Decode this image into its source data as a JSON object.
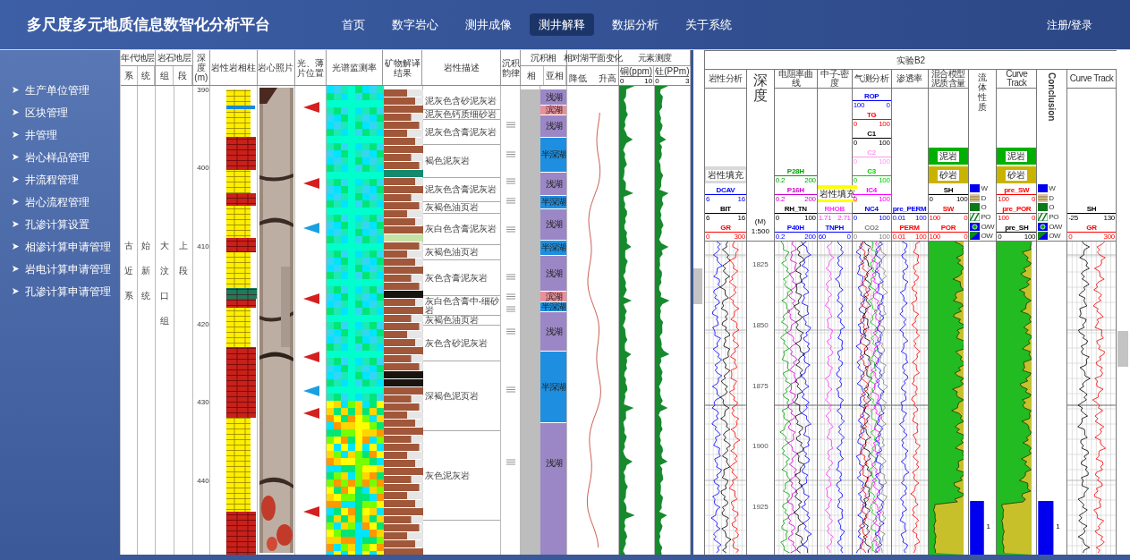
{
  "header": {
    "title": "多尺度多元地质信息数智化分析平台",
    "nav": [
      {
        "label": "首页",
        "selected": false
      },
      {
        "label": "数字岩心",
        "selected": false
      },
      {
        "label": "测井成像",
        "selected": false
      },
      {
        "label": "测井解释",
        "selected": true
      },
      {
        "label": "数据分析",
        "selected": false
      },
      {
        "label": "关于系统",
        "selected": false
      }
    ],
    "login": "注册/登录"
  },
  "sidebar": {
    "items": [
      "生产单位管理",
      "区块管理",
      "井管理",
      "岩心样品管理",
      "井流程管理",
      "岩心流程管理",
      "孔渗计算设置",
      "相渗计算申请管理",
      "岩电计算申请管理",
      "孔渗计算申请管理"
    ]
  },
  "core_log": {
    "columns": [
      {
        "label": "年代地层",
        "sub": [
          "系",
          "统"
        ]
      },
      {
        "label": "岩石地层",
        "sub": [
          "组",
          "段"
        ]
      },
      {
        "label": "深度(m)"
      },
      {
        "label": "岩性岩相柱"
      },
      {
        "label": "岩心照片"
      },
      {
        "label": "光、薄片位置"
      },
      {
        "label": "光谱监测率"
      },
      {
        "label": "矿物解译结果"
      },
      {
        "label": "岩性描述"
      },
      {
        "label": "沉积韵律"
      },
      {
        "label": "沉积相",
        "sub": [
          "相",
          "亚相"
        ]
      },
      {
        "label": "相对湖平面变化",
        "sub": [
          "降低",
          "升高"
        ]
      },
      {
        "label": "元素测度",
        "sub": [
          "铜(ppm)",
          "钍(PPm)"
        ],
        "scales": [
          [
            "0",
            "10"
          ],
          [
            "0",
            "3"
          ]
        ]
      }
    ],
    "strata": [
      "古近系",
      "始新统",
      "大汶口组",
      "上段"
    ],
    "depth_ticks": [
      "390",
      "400",
      "410",
      "420",
      "430",
      "440"
    ],
    "sample_markers": [
      {
        "color": "#d42020"
      },
      {
        "color": "#d42020"
      },
      {
        "color": "#1aa0e0"
      },
      {
        "color": "#d42020"
      },
      {
        "color": "#d42020"
      },
      {
        "color": "#1aa0e0"
      },
      {
        "color": "#d42020"
      },
      {
        "color": "#d42020"
      }
    ],
    "descriptions": [
      "泥灰色含砂泥灰岩",
      "泥灰色钙质细砂岩",
      "泥灰色含膏泥灰岩",
      "褐色泥灰岩",
      "泥灰色含膏泥灰岩",
      "灰褐色油页岩",
      "灰白色含膏泥灰岩",
      "灰褐色油页岩",
      "灰色含膏泥灰岩",
      "灰白色含膏中-细砂岩",
      "灰褐色油页岩",
      "灰色含砂泥灰岩",
      "深褐色泥页岩",
      "灰色泥灰岩"
    ],
    "facies": [
      {
        "label": "浅湖",
        "color": "#9b87c6"
      },
      {
        "label": "滨湖",
        "color": "#e8909a"
      },
      {
        "label": "浅湖",
        "color": "#9b87c6"
      },
      {
        "label": "半深湖",
        "color": "#1e8fe0"
      },
      {
        "label": "浅湖",
        "color": "#9b87c6"
      },
      {
        "label": "半深湖",
        "color": "#1e8fe0"
      },
      {
        "label": "浅湖",
        "color": "#9b87c6"
      },
      {
        "label": "半深湖",
        "color": "#1e8fe0"
      },
      {
        "label": "浅湖",
        "color": "#9b87c6"
      },
      {
        "label": "滨湖",
        "color": "#e8909a"
      },
      {
        "label": "半深湖",
        "color": "#1e8fe0"
      },
      {
        "label": "浅湖",
        "color": "#9b87c6"
      },
      {
        "label": "半深湖",
        "color": "#1e8fe0"
      },
      {
        "label": "浅湖",
        "color": "#9b87c6"
      }
    ]
  },
  "interpretation_log": {
    "title": "实验B2",
    "tracks": [
      {
        "kind": "curves",
        "title": "岩性分析",
        "legend": [
          {
            "kind": "fill",
            "label": "岩性填充",
            "color": "#d9d9d9"
          },
          {
            "kind": "curve",
            "name": "DCAV",
            "color": "#0000ff",
            "min": "6",
            "max": "16"
          },
          {
            "kind": "curve",
            "name": "BIT",
            "color": "#000000",
            "min": "6",
            "max": "16"
          },
          {
            "kind": "curve",
            "name": "GR",
            "color": "#ff0000",
            "min": "0",
            "max": "300"
          }
        ]
      },
      {
        "kind": "depth",
        "title": "深度",
        "unit": "(M)",
        "scale": "1:500",
        "ticks": [
          "1825",
          "1850",
          "1875",
          "1900",
          "1925"
        ]
      },
      {
        "kind": "curves",
        "title": "电阻率曲线",
        "legend": [
          {
            "kind": "curve",
            "name": "P28H",
            "color": "#00a000",
            "min": "0.2",
            "max": "200"
          },
          {
            "kind": "curve",
            "name": "P16H",
            "color": "#cc00cc",
            "min": "0.2",
            "max": "200"
          },
          {
            "kind": "curve",
            "name": "RH_TN",
            "color": "#000000",
            "min": "0",
            "max": "100"
          },
          {
            "kind": "curve",
            "name": "P40H",
            "color": "#0000ff",
            "min": "0.2",
            "max": "200"
          }
        ]
      },
      {
        "kind": "curves",
        "title": "中子-密度",
        "legend": [
          {
            "kind": "fill",
            "label": "岩性填充",
            "color": "#ffff00"
          },
          {
            "kind": "curve",
            "name": "RHOB",
            "color": "#ff33ff",
            "min": "1.71",
            "max": "2.71"
          },
          {
            "kind": "curve",
            "name": "TNPH",
            "color": "#0000ff",
            "min": "60",
            "max": "0"
          }
        ]
      },
      {
        "kind": "curves",
        "title": "气测分析",
        "legend": [
          {
            "kind": "curve",
            "name": "ROP",
            "color": "#0000ff",
            "min": "100",
            "max": "0"
          },
          {
            "kind": "curve",
            "name": "TG",
            "color": "#ff0000",
            "min": "0",
            "max": "100"
          },
          {
            "kind": "curve",
            "name": "C1",
            "color": "#000000",
            "min": "0",
            "max": "100"
          },
          {
            "kind": "curve",
            "name": "C2",
            "color": "#ff99ee",
            "min": "0",
            "max": "100"
          },
          {
            "kind": "curve",
            "name": "C3",
            "color": "#00cc00",
            "min": "0",
            "max": "100"
          },
          {
            "kind": "curve",
            "name": "IC4",
            "color": "#ff00ff",
            "min": "0",
            "max": "100"
          },
          {
            "kind": "curve",
            "name": "NC4",
            "color": "#0000ff",
            "min": "0",
            "max": "100"
          },
          {
            "kind": "curve",
            "name": "CO2",
            "color": "#808080",
            "min": "0",
            "max": "100"
          }
        ]
      },
      {
        "kind": "curves",
        "title": "渗透率",
        "legend": [
          {
            "kind": "curve",
            "name": "pre_PERM",
            "color": "#0000ff",
            "min": "0.01",
            "max": "100"
          },
          {
            "kind": "curve",
            "name": "PERM",
            "color": "#ff0000",
            "min": "0.01",
            "max": "100"
          }
        ]
      },
      {
        "kind": "volume",
        "title": "混合模型泥质含量",
        "legend": [
          {
            "kind": "fill",
            "label": "泥岩",
            "color": "#00b000"
          },
          {
            "kind": "fill",
            "label": "砂岩",
            "color": "#c8b400"
          },
          {
            "kind": "curve",
            "name": "SH",
            "color": "#000000",
            "min": "0",
            "max": "100"
          },
          {
            "kind": "curve",
            "name": "SW",
            "color": "#ff0000",
            "min": "100",
            "max": "0"
          },
          {
            "kind": "curve",
            "name": "POR",
            "color": "#ff0000",
            "min": "100",
            "max": "0"
          }
        ]
      },
      {
        "kind": "fluid",
        "title": "流体性质",
        "value": "1",
        "legend": [
          {
            "kind": "water",
            "label": "W"
          },
          {
            "kind": "dry",
            "label": "D"
          },
          {
            "kind": "oil",
            "label": "O"
          },
          {
            "kind": "poor_oil",
            "label": "PO"
          },
          {
            "kind": "oil_in_water",
            "label": "O/W"
          },
          {
            "kind": "oil_water",
            "label": "OW"
          }
        ]
      },
      {
        "kind": "volume",
        "title": "Curve Track",
        "legend": [
          {
            "kind": "fill",
            "label": "泥岩",
            "color": "#00b000"
          },
          {
            "kind": "fill",
            "label": "砂岩",
            "color": "#c8b400"
          },
          {
            "kind": "curve",
            "name": "pre_SW",
            "color": "#ff0000",
            "min": "100",
            "max": "0"
          },
          {
            "kind": "curve",
            "name": "pre_POR",
            "color": "#ff0000",
            "min": "100",
            "max": "0"
          },
          {
            "kind": "curve",
            "name": "pre_SH",
            "color": "#000000",
            "min": "0",
            "max": "100"
          }
        ]
      },
      {
        "kind": "conclusion",
        "title": "Conclusion",
        "value": "1",
        "legend": [
          {
            "kind": "water",
            "label": "W"
          },
          {
            "kind": "dry",
            "label": "D"
          },
          {
            "kind": "oil",
            "label": "O"
          },
          {
            "kind": "poor_oil",
            "label": "PO"
          },
          {
            "kind": "oil_in_water",
            "label": "O/W"
          },
          {
            "kind": "oil_water",
            "label": "OW"
          }
        ]
      },
      {
        "kind": "curves",
        "title": "Curve Track",
        "legend": [
          {
            "kind": "curve",
            "name": "SH",
            "color": "#000000",
            "min": "-25",
            "max": "130"
          },
          {
            "kind": "curve",
            "name": "GR",
            "color": "#ff0000",
            "min": "0",
            "max": "300"
          }
        ]
      }
    ]
  }
}
